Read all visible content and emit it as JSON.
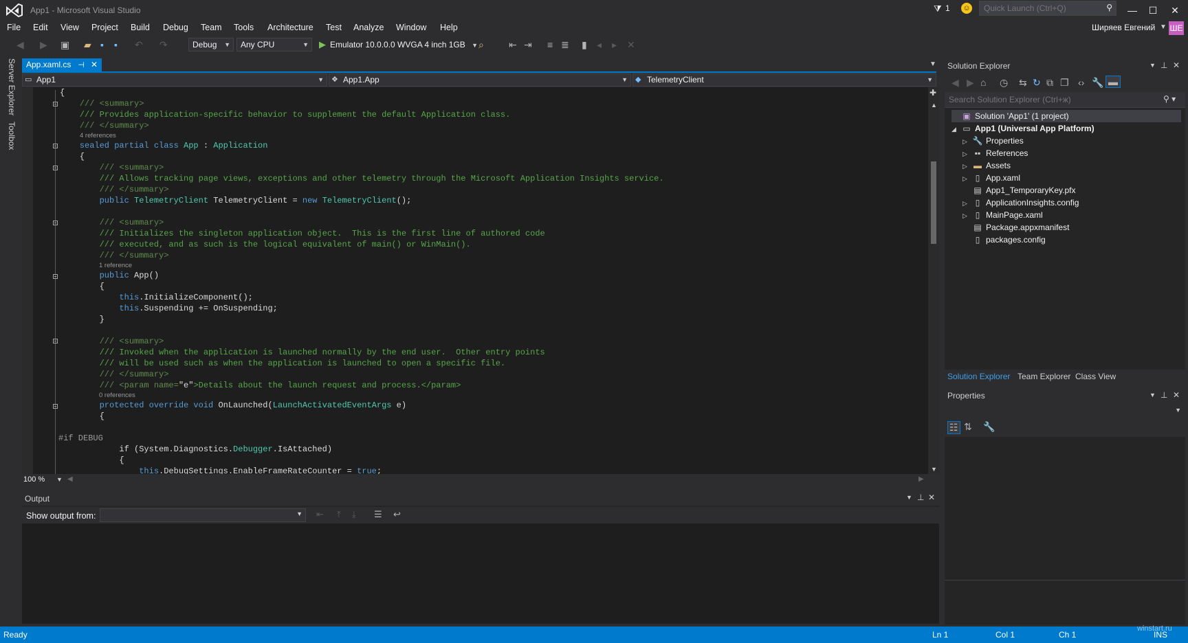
{
  "window": {
    "title": "App1 - Microsoft Visual Studio",
    "notification_count": "1",
    "quick_launch_placeholder": "Quick Launch (Ctrl+Q)",
    "user_name": "Ширяев Евгений",
    "user_initials": "ШЕ"
  },
  "menu": [
    "File",
    "Edit",
    "View",
    "Project",
    "Build",
    "Debug",
    "Team",
    "Tools",
    "Architecture",
    "Test",
    "Analyze",
    "Window",
    "Help"
  ],
  "toolbar": {
    "configuration": "Debug",
    "platform": "Any CPU",
    "run_target": "Emulator 10.0.0.0 WVGA 4 inch 1GB"
  },
  "left_strip": [
    "Server Explorer",
    "Toolbox"
  ],
  "editor": {
    "tab_label": "App.xaml.cs",
    "nav_project": "App1",
    "nav_type": "App1.App",
    "nav_member": "TelemetryClient",
    "zoom": "100 %",
    "code": {
      "l0": "{",
      "l1": "    /// <summary>",
      "l2": "    /// Provides application-specific behavior to supplement the default Application class.",
      "l3": "    /// </summary>",
      "lens1": "4 references",
      "l4a": "    sealed partial class ",
      "l4b": "App",
      "l4c": " : ",
      "l4d": "Application",
      "l5": "    {",
      "l6": "        /// <summary>",
      "l7": "        /// Allows tracking page views, exceptions and other telemetry through the Microsoft Application Insights service.",
      "l8": "        /// </summary>",
      "l9a": "        public ",
      "l9b": "TelemetryClient",
      "l9c": " TelemetryClient = ",
      "l9d": "new ",
      "l9e": "TelemetryClient",
      "l9f": "();",
      "l10": "        /// <summary>",
      "l11": "        /// Initializes the singleton application object.  This is the first line of authored code",
      "l12": "        /// executed, and as such is the logical equivalent of main() or WinMain().",
      "l13": "        /// </summary>",
      "lens2": "1 reference",
      "l14a": "        public ",
      "l14b": "App()",
      "l15": "        {",
      "l16a": "            this",
      "l16b": ".InitializeComponent();",
      "l17a": "            this",
      "l17b": ".Suspending += OnSuspending;",
      "l18": "        }",
      "l19": "        /// <summary>",
      "l20": "        /// Invoked when the application is launched normally by the end user.  Other entry points",
      "l21": "        /// will be used such as when the application is launched to open a specific file.",
      "l22": "        /// </summary>",
      "l23a": "        /// <param name=",
      "l23b": "\"e\"",
      "l23c": ">Details about the launch request and process.</param>",
      "lens3": "0 references",
      "l24a": "        protected override void ",
      "l24b": "OnLaunched(",
      "l24c": "LaunchActivatedEventArgs",
      "l24d": " e)",
      "l25": "        {",
      "l26": "#if DEBUG",
      "l27a": "            if (System.Diagnostics.",
      "l27b": "Debugger",
      "l27c": ".IsAttached)",
      "l28": "            {",
      "l29a": "                this",
      "l29b": ".DebugSettings.EnableFrameRateCounter = ",
      "l29c": "true",
      "l29d": ";"
    }
  },
  "output": {
    "title": "Output",
    "show_output_from": "Show output from:",
    "source_value": ""
  },
  "solution_explorer": {
    "title": "Solution Explorer",
    "search_placeholder": "Search Solution Explorer (Ctrl+ж)",
    "solution": "Solution 'App1' (1 project)",
    "project": "App1 (Universal App Platform)",
    "items": [
      "Properties",
      "References",
      "Assets",
      "App.xaml",
      "App1_TemporaryKey.pfx",
      "ApplicationInsights.config",
      "MainPage.xaml",
      "Package.appxmanifest",
      "packages.config"
    ],
    "tabs": [
      "Solution Explorer",
      "Team Explorer",
      "Class View"
    ]
  },
  "properties": {
    "title": "Properties"
  },
  "status": {
    "ready": "Ready",
    "line": "Ln 1",
    "col": "Col 1",
    "ch": "Ch 1",
    "mode": "INS",
    "watermark": "winstart.ru"
  },
  "colors": {
    "accent": "#007acc",
    "background": "#2d2d30",
    "editor": "#1e1e1e",
    "comment": "#57a64a",
    "keyword": "#569cd6",
    "type": "#4ec9b0"
  }
}
